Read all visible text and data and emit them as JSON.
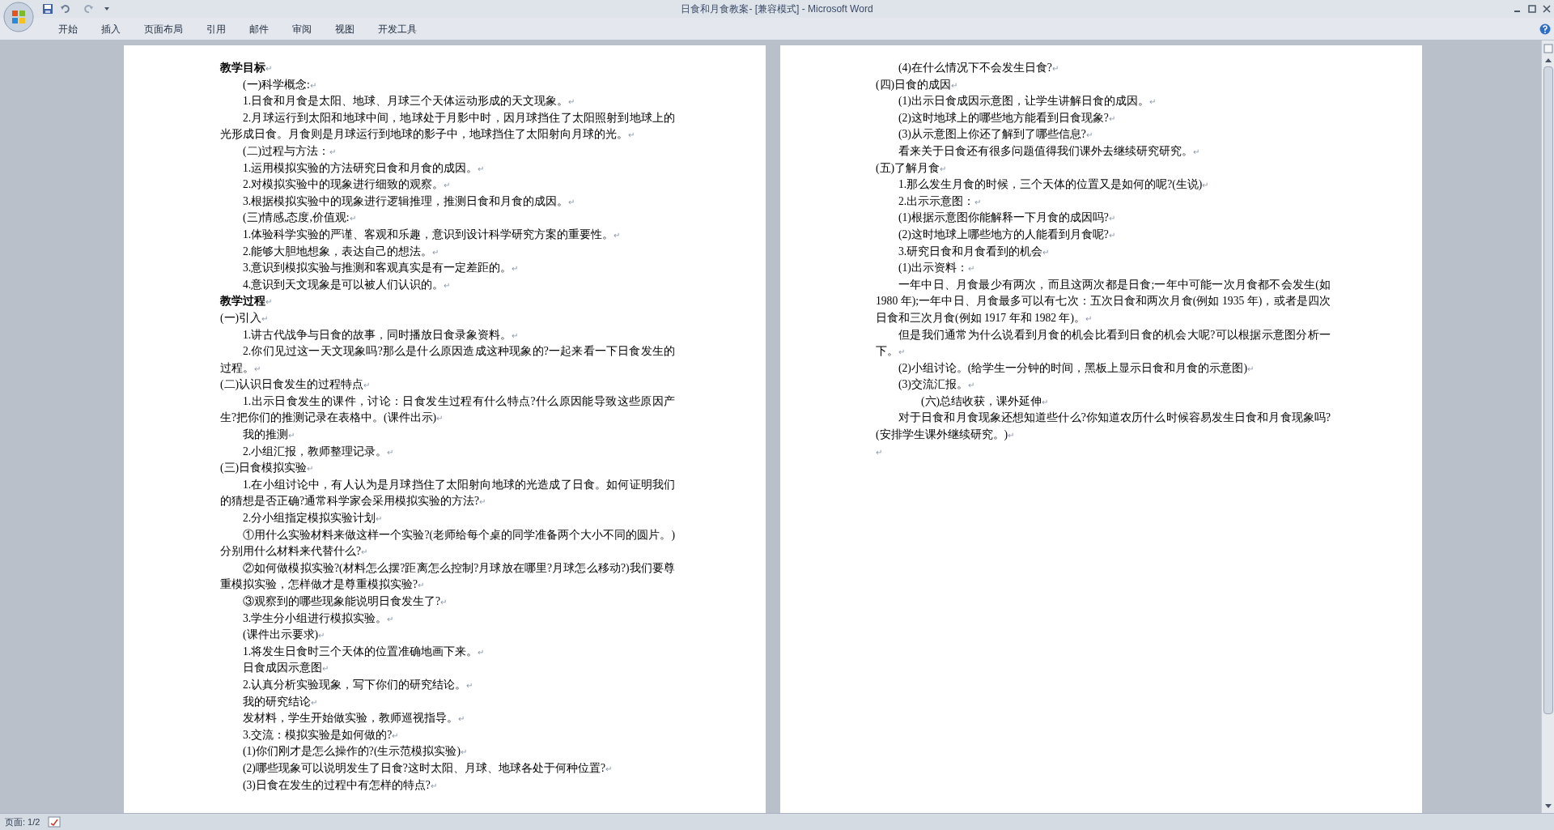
{
  "window": {
    "title": "日食和月食教案- [兼容模式] - Microsoft Word"
  },
  "ribbon_tabs": [
    {
      "label": "开始",
      "selected": false
    },
    {
      "label": "插入",
      "selected": false
    },
    {
      "label": "页面布局",
      "selected": false
    },
    {
      "label": "引用",
      "selected": false
    },
    {
      "label": "邮件",
      "selected": false
    },
    {
      "label": "审阅",
      "selected": false
    },
    {
      "label": "视图",
      "selected": false
    },
    {
      "label": "开发工具",
      "selected": false
    }
  ],
  "pages": [
    {
      "paragraphs": [
        {
          "kind": "heading",
          "text": "教学目标",
          "mark": "↵"
        },
        {
          "kind": "indent",
          "text": "(一)科学概念:",
          "mark": "↵"
        },
        {
          "kind": "indent",
          "text": "1.日食和月食是太阳、地球、月球三个天体运动形成的天文现象。",
          "mark": "↵"
        },
        {
          "kind": "indent",
          "text": "2.月球运行到太阳和地球中间，地球处于月影中时，因月球挡住了太阳照射到地球上的光形成日食。月食则是月球运行到地球的影子中，地球挡住了太阳射向月球的光。",
          "mark": "↵"
        },
        {
          "kind": "indent",
          "text": "(二)过程与方法：",
          "mark": "↵"
        },
        {
          "kind": "indent",
          "text": "1.运用模拟实验的方法研究日食和月食的成因。",
          "mark": "↵"
        },
        {
          "kind": "indent",
          "text": "2.对模拟实验中的现象进行细致的观察。",
          "mark": "↵"
        },
        {
          "kind": "indent",
          "text": "3.根据模拟实验中的现象进行逻辑推理，推测日食和月食的成因。",
          "mark": "↵"
        },
        {
          "kind": "indent",
          "text": "(三)情感,态度,价值观:",
          "mark": "↵"
        },
        {
          "kind": "indent",
          "text": "1.体验科学实验的严谨、客观和乐趣，意识到设计科学研究方案的重要性。",
          "mark": "↵"
        },
        {
          "kind": "indent",
          "text": "2.能够大胆地想象，表达自己的想法。",
          "mark": "↵"
        },
        {
          "kind": "indent",
          "text": "3.意识到模拟实验与推测和客观真实是有一定差距的。",
          "mark": "↵"
        },
        {
          "kind": "indent",
          "text": "4.意识到天文现象是可以被人们认识的。",
          "mark": "↵"
        },
        {
          "kind": "heading",
          "text": "教学过程",
          "mark": "↵"
        },
        {
          "kind": "flush",
          "text": "(一)引入",
          "mark": "↵"
        },
        {
          "kind": "indent",
          "text": "1.讲古代战争与日食的故事，同时播放日食录象资料。",
          "mark": "↵"
        },
        {
          "kind": "indent",
          "text": "2.你们见过这一天文现象吗?那么是什么原因造成这种现象的?一起来看一下日食发生的过程。",
          "mark": "↵"
        },
        {
          "kind": "flush",
          "text": "(二)认识日食发生的过程特点",
          "mark": "↵"
        },
        {
          "kind": "indent",
          "text": "1.出示日食发生的课件，讨论：日食发生过程有什么特点?什么原因能导致这些原因产生?把你们的推测记录在表格中。(课件出示)",
          "mark": "↵"
        },
        {
          "kind": "indent",
          "text": "我的推测",
          "mark": "↵"
        },
        {
          "kind": "indent",
          "text": "2.小组汇报，教师整理记录。",
          "mark": "↵"
        },
        {
          "kind": "flush",
          "text": "(三)日食模拟实验",
          "mark": "↵"
        },
        {
          "kind": "indent",
          "text": "1.在小组讨论中，有人认为是月球挡住了太阳射向地球的光造成了日食。如何证明我们的猜想是否正确?通常科学家会采用模拟实验的方法?",
          "mark": "↵"
        },
        {
          "kind": "indent",
          "text": "2.分小组指定模拟实验计划",
          "mark": "↵"
        },
        {
          "kind": "indent",
          "text": "①用什么实验材料来做这样一个实验?(老师给每个桌的同学准备两个大小不同的圆片。)分别用什么材料来代替什么?",
          "mark": "↵"
        },
        {
          "kind": "indent",
          "text": "②如何做模拟实验?(材料怎么摆?距离怎么控制?月球放在哪里?月球怎么移动?)我们要尊重模拟实验，怎样做才是尊重模拟实验?",
          "mark": "↵"
        },
        {
          "kind": "indent",
          "text": "③观察到的哪些现象能说明日食发生了?",
          "mark": "↵"
        },
        {
          "kind": "indent",
          "text": "3.学生分小组进行模拟实验。",
          "mark": "↵"
        },
        {
          "kind": "indent",
          "text": "(课件出示要求)",
          "mark": "↵"
        },
        {
          "kind": "indent",
          "text": "1.将发生日食时三个天体的位置准确地画下来。",
          "mark": "↵"
        },
        {
          "kind": "indent",
          "text": "日食成因示意图",
          "mark": "↵"
        },
        {
          "kind": "indent",
          "text": "2.认真分析实验现象，写下你们的研究结论。",
          "mark": "↵"
        },
        {
          "kind": "indent",
          "text": "我的研究结论",
          "mark": "↵"
        },
        {
          "kind": "indent",
          "text": "发材料，学生开始做实验，教师巡视指导。",
          "mark": "↵"
        },
        {
          "kind": "indent",
          "text": "3.交流：模拟实验是如何做的?",
          "mark": "↵"
        },
        {
          "kind": "indent",
          "text": "(1)你们刚才是怎么操作的?(生示范模拟实验)",
          "mark": "↵"
        },
        {
          "kind": "indent",
          "text": "(2)哪些现象可以说明发生了日食?这时太阳、月球、地球各处于何种位置?",
          "mark": "↵"
        },
        {
          "kind": "indent",
          "text": "(3)日食在发生的过程中有怎样的特点?",
          "mark": "↵"
        }
      ]
    },
    {
      "paragraphs": [
        {
          "kind": "indent",
          "text": "(4)在什么情况下不会发生日食?",
          "mark": "↵"
        },
        {
          "kind": "flush",
          "text": "(四)日食的成因",
          "mark": "↵"
        },
        {
          "kind": "indent",
          "text": "(1)出示日食成因示意图，让学生讲解日食的成因。",
          "mark": "↵"
        },
        {
          "kind": "indent",
          "text": "(2)这时地球上的哪些地方能看到日食现象?",
          "mark": "↵"
        },
        {
          "kind": "indent",
          "text": "(3)从示意图上你还了解到了哪些信息?",
          "mark": "↵"
        },
        {
          "kind": "indent",
          "text": "看来关于日食还有很多问题值得我们课外去继续研究研究。",
          "mark": "↵"
        },
        {
          "kind": "flush",
          "text": "(五)了解月食",
          "mark": "↵"
        },
        {
          "kind": "indent",
          "text": "1.那么发生月食的时候，三个天体的位置又是如何的呢?(生说)",
          "mark": "↵"
        },
        {
          "kind": "indent",
          "text": "2.出示示意图：",
          "mark": "↵"
        },
        {
          "kind": "indent",
          "text": "(1)根据示意图你能解释一下月食的成因吗?",
          "mark": "↵"
        },
        {
          "kind": "indent",
          "text": "(2)这时地球上哪些地方的人能看到月食呢?",
          "mark": "↵"
        },
        {
          "kind": "indent",
          "text": "3.研究日食和月食看到的机会",
          "mark": "↵"
        },
        {
          "kind": "indent",
          "text": "(1)出示资料：",
          "mark": "↵"
        },
        {
          "kind": "indent",
          "text": "一年中日、月食最少有两次，而且这两次都是日食;一年中可能一次月食都不会发生(如1980 年);一年中日、月食最多可以有七次：五次日食和两次月食(例如 1935 年)，或者是四次日食和三次月食(例如 1917 年和 1982 年)。",
          "mark": "↵"
        },
        {
          "kind": "indent",
          "text": "但是我们通常为什么说看到月食的机会比看到日食的机会大呢?可以根据示意图分析一下。",
          "mark": "↵"
        },
        {
          "kind": "indent",
          "text": "(2)小组讨论。(给学生一分钟的时间，黑板上显示日食和月食的示意图)",
          "mark": "↵"
        },
        {
          "kind": "indent",
          "text": "(3)交流汇报。",
          "mark": "↵"
        },
        {
          "kind": "indent4",
          "text": "(六)总结收获，课外延伸",
          "mark": "↵"
        },
        {
          "kind": "indent",
          "text": "对于日食和月食现象还想知道些什么?你知道农历什么时候容易发生日食和月食现象吗?(安排学生课外继续研究。)",
          "mark": "↵"
        },
        {
          "kind": "flush",
          "mark": "↵"
        }
      ]
    }
  ],
  "status_bar": {
    "page": "页面: 1/2"
  }
}
